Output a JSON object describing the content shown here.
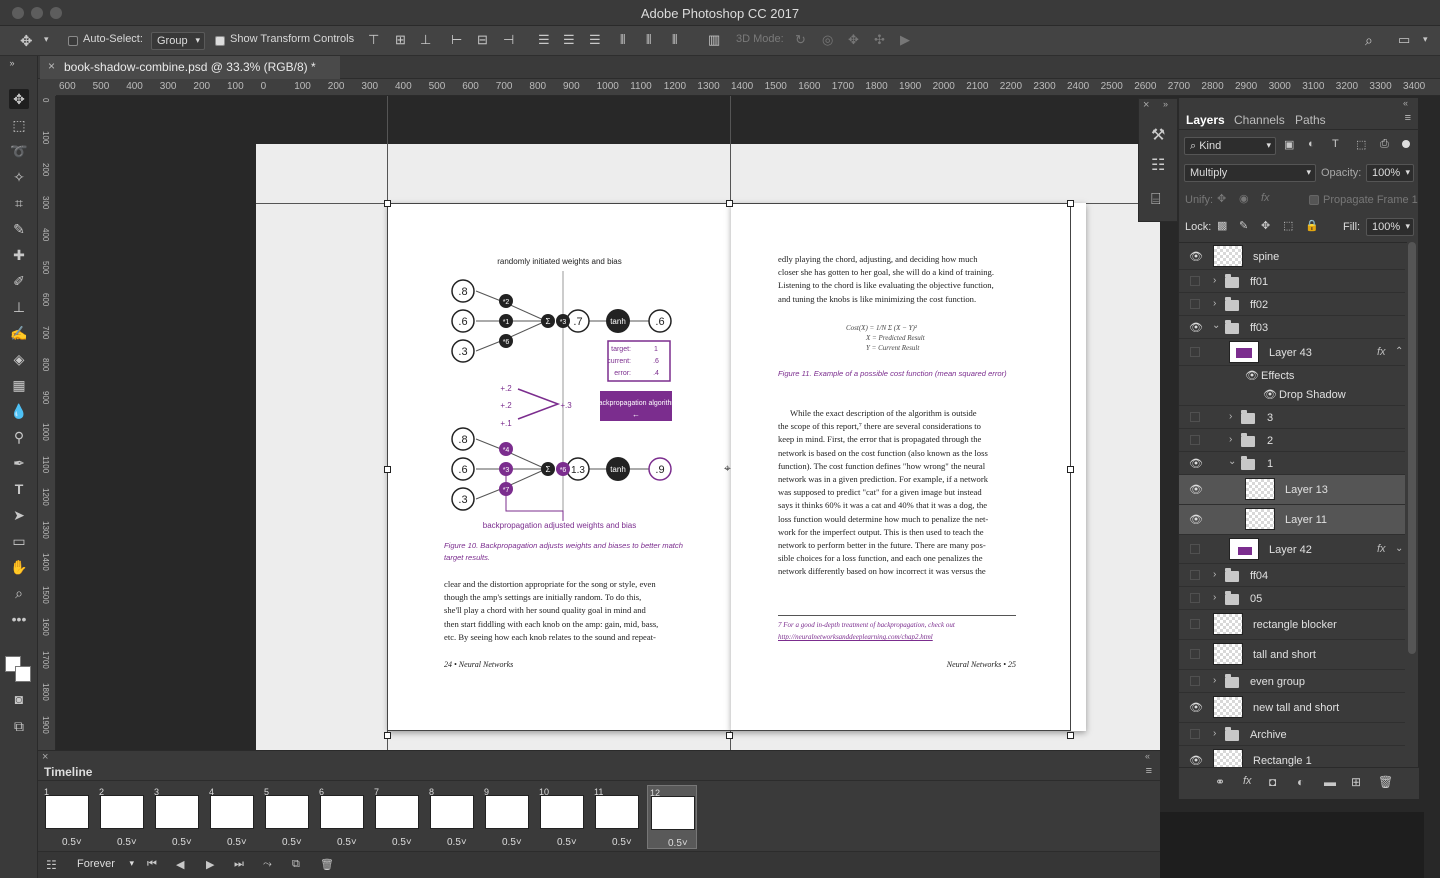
{
  "app": {
    "title": "Adobe Photoshop CC 2017"
  },
  "options_bar": {
    "auto_select_label": "Auto-Select:",
    "auto_select_value": "Group",
    "show_transform_label": "Show Transform Controls",
    "mode_3d_label": "3D Mode:"
  },
  "document": {
    "tab_title": "book-shadow-combine.psd @ 33.3% (RGB/8) *"
  },
  "rulers": {
    "h_ticks": [
      "600",
      "500",
      "400",
      "300",
      "200",
      "100",
      "0",
      "100",
      "200",
      "300",
      "400",
      "500",
      "600",
      "700",
      "800",
      "900",
      "1000",
      "1100",
      "1200",
      "1300",
      "1400",
      "1500",
      "1600",
      "1700",
      "1800",
      "1900",
      "2000",
      "2100",
      "2200",
      "2300",
      "2400",
      "2500",
      "2600",
      "2700",
      "2800",
      "2900",
      "3000",
      "3100",
      "3200",
      "3300",
      "3400"
    ],
    "v_ticks": [
      "0",
      "100",
      "200",
      "300",
      "400",
      "500",
      "600",
      "700",
      "800",
      "900",
      "1000",
      "1100",
      "1200",
      "1300",
      "1400",
      "1500",
      "1600",
      "1700",
      "1800",
      "1900"
    ]
  },
  "page_left": {
    "diagram_title": "randomly initiated weights and bias",
    "top_inputs": [
      ".8",
      ".6",
      ".3"
    ],
    "top_weights": [
      "*2",
      "*1",
      "*6"
    ],
    "sum": "Σ",
    "top_mult": "*3",
    "top_hidden": ".7",
    "activation": "tanh",
    "top_output": ".6",
    "target_label": "target:",
    "target_value": "1",
    "current_label": "current:",
    "current_value": ".6",
    "error_label": "error:",
    "error_value": ".4",
    "delta_values": [
      "+.2",
      "+.2",
      "+.1"
    ],
    "delta_mult": "+.3",
    "backprop_box": "backpropagation algorithm",
    "backprop_arrow": "←",
    "bottom_inputs": [
      ".8",
      ".6",
      ".3"
    ],
    "bottom_weights": [
      "*4",
      "*3",
      "*7"
    ],
    "bottom_mult": "*6",
    "bottom_hidden": "1.3",
    "bottom_output": ".9",
    "diagram_footer": "backpropagation adjusted weights and bias",
    "caption": "Figure 10. Backpropagation adjusts weights and biases to better match target results.",
    "body_lines": [
      "clear and the distortion appropriate for the song or style, even",
      "though the amp's settings are initially random. To do this,",
      "she'll play a chord with her sound quality goal in mind and",
      "then start fiddling with each knob on the amp: gain, mid, bass,",
      "etc. By seeing how each knob relates to the sound and repeat-"
    ],
    "footer": "24 • Neural Networks"
  },
  "page_right": {
    "top_lines": [
      "edly playing the chord, adjusting, and deciding how much",
      "closer she has gotten to her goal, she will do a kind of training.",
      "Listening to the chord is like evaluating the objective function,",
      "and tuning the knobs is like minimizing the cost function."
    ],
    "formula_main": "Cost(X) = 1/N Σ (X − Y)²",
    "formula_x": "X = Predicted Result",
    "formula_y": "Y = Current Result",
    "caption": "Figure 11. Example of a possible cost function (mean squared error)",
    "body_lines": [
      "While the exact description of the algorithm is outside",
      "the scope of this report,⁷ there are several considerations to",
      "keep in mind. First, the error that is propagated through the",
      "network is based on the cost function (also known as the loss",
      "function). The cost function defines \"how wrong\" the neural",
      "network was in a given prediction. For example, if a network",
      "was supposed to predict \"cat\" for a given image but instead",
      "says it thinks 60% it was a cat and 40% that it was a dog, the",
      "loss function would determine how much to penalize the net-",
      "work for the imperfect output. This is then used to teach the",
      "network to perform better in the future. There are many pos-",
      "sible choices for a loss function, and each one penalizes the",
      "network differently based on how incorrect it was versus the"
    ],
    "footnote": "7  For a good in-depth treatment of backpropagation, check out",
    "footnote_link": "http://neuralnetworksanddeeplearning.com/chap2.html",
    "footer": "Neural Networks • 25"
  },
  "layers_panel": {
    "tabs": [
      "Layers",
      "Channels",
      "Paths"
    ],
    "filter_kind": "Kind",
    "blend_mode": "Multiply",
    "opacity_label": "Opacity:",
    "opacity_value": "100%",
    "unify_label": "Unify:",
    "propagate_label": "Propagate Frame 1",
    "lock_label": "Lock:",
    "fill_label": "Fill:",
    "fill_value": "100%",
    "layers": [
      {
        "name": "spine",
        "visible": true,
        "kind": "layer"
      },
      {
        "name": "ff01",
        "visible": false,
        "kind": "group"
      },
      {
        "name": "ff02",
        "visible": false,
        "kind": "group"
      },
      {
        "name": "ff03",
        "visible": true,
        "kind": "group-open"
      },
      {
        "name": "Layer 43",
        "visible": false,
        "kind": "layer-fx"
      },
      {
        "name": "Effects",
        "visible": true,
        "kind": "effects"
      },
      {
        "name": "Drop Shadow",
        "visible": true,
        "kind": "effect"
      },
      {
        "name": "3",
        "visible": false,
        "kind": "group"
      },
      {
        "name": "2",
        "visible": false,
        "kind": "group"
      },
      {
        "name": "1",
        "visible": true,
        "kind": "group-open"
      },
      {
        "name": "Layer 13",
        "visible": true,
        "kind": "layer-sel"
      },
      {
        "name": "Layer 11",
        "visible": true,
        "kind": "layer-sel"
      },
      {
        "name": "Layer 42",
        "visible": false,
        "kind": "layer-fx"
      },
      {
        "name": "ff04",
        "visible": false,
        "kind": "group"
      },
      {
        "name": "05",
        "visible": false,
        "kind": "group"
      },
      {
        "name": "rectangle blocker",
        "visible": false,
        "kind": "layer"
      },
      {
        "name": "tall and short",
        "visible": false,
        "kind": "layer"
      },
      {
        "name": "even group",
        "visible": false,
        "kind": "group"
      },
      {
        "name": "new tall and short",
        "visible": true,
        "kind": "layer"
      },
      {
        "name": "Archive",
        "visible": false,
        "kind": "group"
      },
      {
        "name": "Rectangle 1",
        "visible": true,
        "kind": "layer"
      }
    ]
  },
  "timeline": {
    "title": "Timeline",
    "frames": [
      {
        "num": "1",
        "dur": "0.5"
      },
      {
        "num": "2",
        "dur": "0.5"
      },
      {
        "num": "3",
        "dur": "0.5"
      },
      {
        "num": "4",
        "dur": "0.5"
      },
      {
        "num": "5",
        "dur": "0.5"
      },
      {
        "num": "6",
        "dur": "0.5"
      },
      {
        "num": "7",
        "dur": "0.5"
      },
      {
        "num": "8",
        "dur": "0.5"
      },
      {
        "num": "9",
        "dur": "0.5"
      },
      {
        "num": "10",
        "dur": "0.5"
      },
      {
        "num": "11",
        "dur": "0.5"
      },
      {
        "num": "12",
        "dur": "0.5"
      }
    ],
    "loop_value": "Forever"
  },
  "colors": {
    "accent_purple": "#7b2d8e",
    "panel_bg": "#3a3a3a",
    "canvas_bg": "#282828"
  }
}
